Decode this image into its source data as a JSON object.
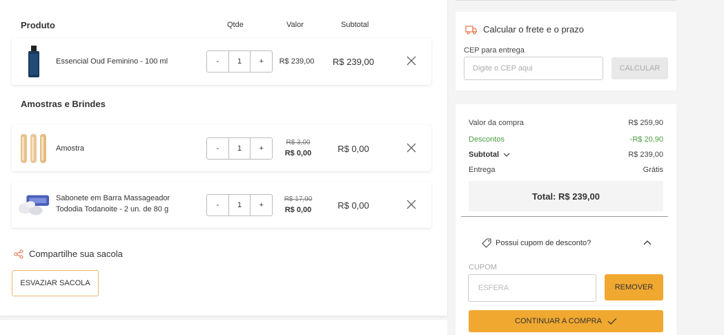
{
  "cart": {
    "headers": {
      "product": "Produto",
      "qty": "Qtde",
      "value": "Valor",
      "subtotal": "Subtotal"
    },
    "items": [
      {
        "name": "Essencial Oud Feminino - 100 ml",
        "qty_minus": "-",
        "qty": "1",
        "qty_plus": "+",
        "value": "R$ 239,00",
        "subtotal": "R$ 239,00",
        "icon": "perfume-bottle-icon"
      }
    ],
    "samples_title": "Amostras e Brindes",
    "samples": [
      {
        "name": "Amostra",
        "qty_minus": "-",
        "qty": "1",
        "qty_plus": "+",
        "old_price": "R$ 3,00",
        "new_price": "R$ 0,00",
        "subtotal": "R$ 0,00",
        "icon": "sample-vials-icon"
      },
      {
        "name_line1": "Sabonete em Barra Massageador",
        "name_line2": "Tododia Todanoite - 2 un. de 80 g",
        "qty_minus": "-",
        "qty": "1",
        "qty_plus": "+",
        "old_price": "R$ 17,90",
        "new_price": "R$ 0,00",
        "subtotal": "R$ 0,00",
        "icon": "soap-bar-icon"
      }
    ],
    "share_label": "Compartilhe sua sacola",
    "empty_button": "ESVAZIAR SACOLA"
  },
  "shipping": {
    "title": "Calcular o frete e o prazo",
    "cep_label": "CEP para entrega",
    "cep_placeholder": "Digite o CEP aqui",
    "calc_button": "CALCULAR"
  },
  "summary": {
    "purchase_label": "Valor da compra",
    "purchase_value": "R$ 259,90",
    "discount_label": "Descontos",
    "discount_value": "-R$ 20,90",
    "subtotal_label": "Subtotal",
    "subtotal_value": "R$ 239,00",
    "delivery_label": "Entrega",
    "delivery_value": "Grátis",
    "total": "Total: R$ 239,00",
    "coupon_toggle": "Possui cupom de desconto?",
    "coupon_label": "CUPOM",
    "coupon_value": "ESFERA",
    "remove_button": "REMOVER",
    "continue_button": "CONTINUAR A COMPRA"
  },
  "colors": {
    "accent": "#f0a830",
    "discount_green": "#4a9d3f",
    "truck_icon": "#e8734a"
  }
}
